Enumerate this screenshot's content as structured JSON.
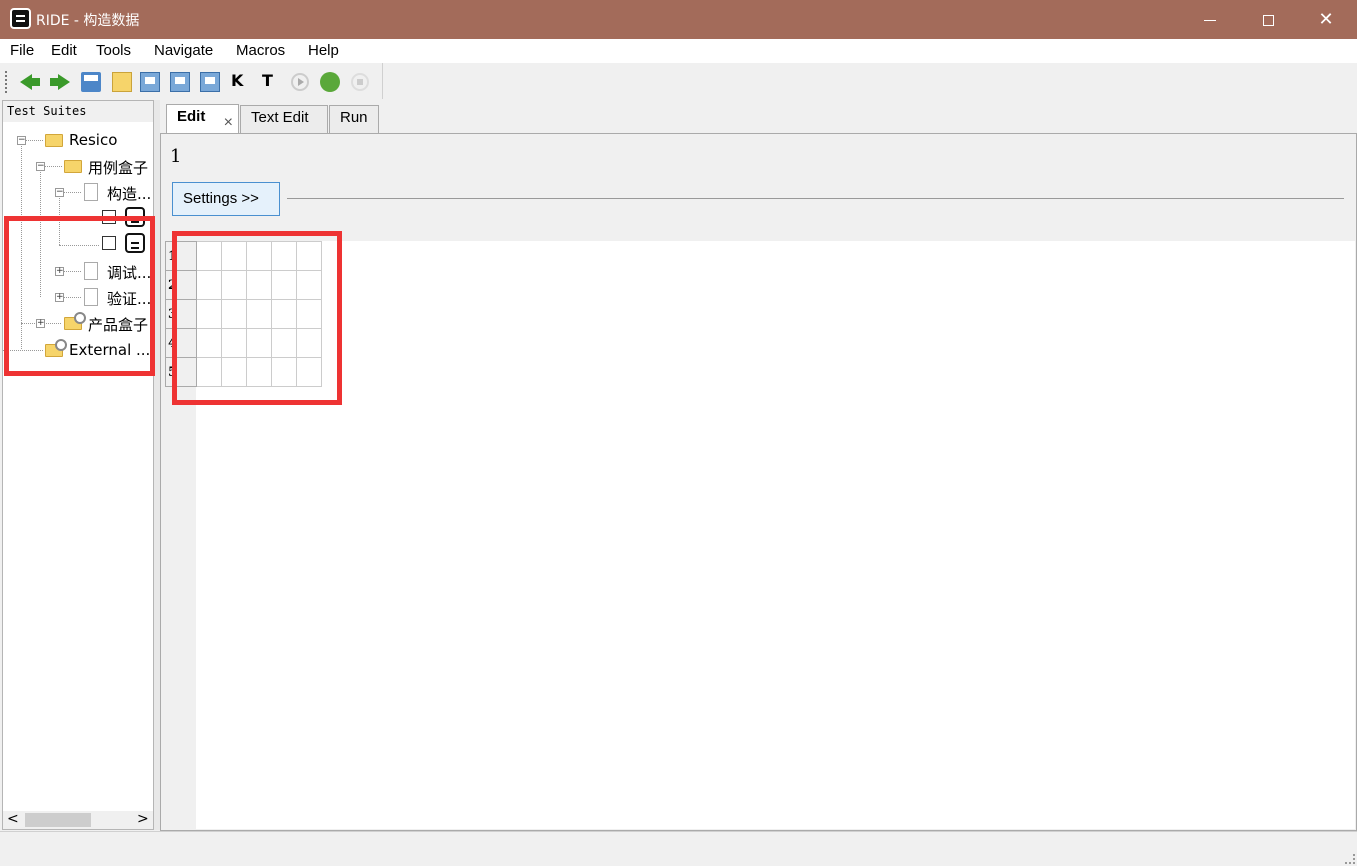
{
  "window": {
    "title": "RIDE - 构造数据"
  },
  "menu": {
    "items": [
      {
        "label": "File"
      },
      {
        "label": "Edit"
      },
      {
        "label": "Tools"
      },
      {
        "label": "Navigate"
      },
      {
        "label": "Macros"
      },
      {
        "label": "Help"
      }
    ]
  },
  "toolbar": {
    "icons": [
      "arrow-left-icon",
      "arrow-right-icon",
      "open-icon",
      "new-icon",
      "save-icon",
      "save-all-icon",
      "save-as-icon",
      "search-keywords-icon",
      "search-tests-icon",
      "run-icon",
      "debug-icon",
      "stop-icon"
    ]
  },
  "tree": {
    "title": "Test Suites",
    "nodes": [
      {
        "label": "Resico"
      },
      {
        "label": "用例盒子"
      },
      {
        "label": "构造..."
      },
      {
        "label": "调试..."
      },
      {
        "label": "验证..."
      },
      {
        "label": "产品盒子"
      },
      {
        "label": "External ..."
      }
    ]
  },
  "tabs": [
    {
      "label": "Edit"
    },
    {
      "label": "Text Edit"
    },
    {
      "label": "Run"
    }
  ],
  "editor": {
    "name": "1",
    "settings_label": "Settings >>",
    "row_numbers": [
      "1",
      "2",
      "3",
      "4",
      "5"
    ]
  },
  "colors": {
    "titlebar": "#a36b5a",
    "highlight": "#ee3333",
    "settings_border": "#4a90d0"
  }
}
